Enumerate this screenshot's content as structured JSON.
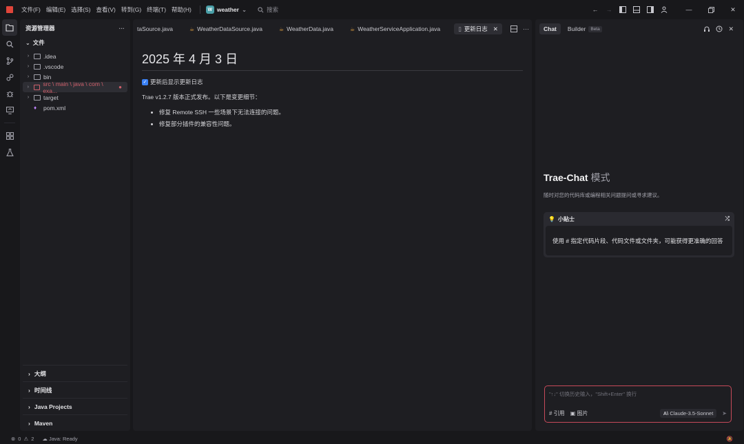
{
  "menubar": {
    "items": [
      "文件(F)",
      "编辑(E)",
      "选择(S)",
      "查看(V)",
      "转到(G)",
      "终端(T)",
      "帮助(H)"
    ],
    "project": {
      "badge": "W",
      "name": "weather"
    },
    "search_placeholder": "搜索"
  },
  "explorer": {
    "title": "资源管理器",
    "section": "文件",
    "tree": [
      {
        "label": ".idea",
        "type": "folder"
      },
      {
        "label": ".vscode",
        "type": "folder"
      },
      {
        "label": "bin",
        "type": "folder"
      },
      {
        "label": "src \\ main \\ java \\ com \\ exa...",
        "type": "folder",
        "selected": true
      },
      {
        "label": "target",
        "type": "folder"
      },
      {
        "label": "pom.xml",
        "type": "file"
      }
    ],
    "bottom_sections": [
      "大纲",
      "时间线",
      "Java Projects",
      "Maven"
    ]
  },
  "editor": {
    "tabs": [
      {
        "label": "taSource.java",
        "icon": false
      },
      {
        "label": "WeatherDataSource.java",
        "icon": true
      },
      {
        "label": "WeatherData.java",
        "icon": true
      },
      {
        "label": "WeatherServiceApplication.java",
        "icon": true
      },
      {
        "label": "更新日志",
        "icon": false,
        "active": true
      }
    ],
    "doc": {
      "title": "2025 年 4 月 3 日",
      "checkbox_label": "更新后显示更新日志",
      "intro": "Trae v1.2.7 版本正式发布。以下是变更细节：",
      "bullets": [
        "修复 Remote SSH 一些场景下无法连接的问题。",
        "修复部分插件的兼容性问题。"
      ]
    }
  },
  "chat": {
    "tabs": {
      "chat": "Chat",
      "builder": "Builder",
      "beta": "Beta"
    },
    "title_main": "Trae-Chat",
    "title_mode": "模式",
    "subtitle": "随时对您的代码库或编程相关问题提问或寻求建议。",
    "tip": {
      "title": "小贴士",
      "body": "使用 # 指定代码片段、代码文件或文件夹，可能获得更准确的回答"
    },
    "input": {
      "placeholder": "\"↑↓\" 切换历史输入，\"Shift+Enter\" 换行",
      "ref_label": "引用",
      "image_label": "图片",
      "model": "Claude-3.5-Sonnet"
    }
  },
  "statusbar": {
    "errors": "0",
    "warnings": "2",
    "java_status": "Java: Ready"
  }
}
